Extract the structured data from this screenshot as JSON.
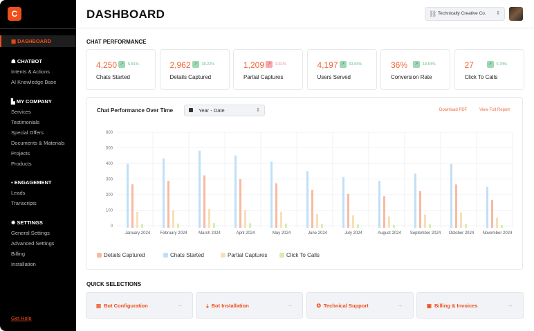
{
  "sidebar": {
    "logo": "C",
    "active": "DASHBOARD",
    "sections": [
      {
        "title": "CHATBOT",
        "icon": "robot-icon",
        "items": [
          "Intents & Actions",
          "AI Knowledge Base"
        ]
      },
      {
        "title": "MY COMPANY",
        "icon": "building-icon",
        "items": [
          "Services",
          "Testimonials",
          "Special Offers",
          "Documents & Materials",
          "Projects",
          "Products"
        ]
      },
      {
        "title": "ENGAGEMENT",
        "icon": "chat-icon",
        "items": [
          "Leads",
          "Transcripts"
        ]
      },
      {
        "title": "SETTINGS",
        "icon": "gear-icon",
        "items": [
          "General Settings",
          "Advanced Settings",
          "Billing",
          "Installation"
        ]
      }
    ],
    "help": "Get Help"
  },
  "header": {
    "title": "DASHBOARD",
    "company": "Technically Creative Co."
  },
  "performance": {
    "title": "CHAT PERFORMANCE",
    "cards": [
      {
        "value": "4,250",
        "change": "5.81%",
        "trend": "up",
        "label": "Chats Started"
      },
      {
        "value": "2,962",
        "change": "38.22%",
        "trend": "up",
        "label": "Details Captured"
      },
      {
        "value": "1,209",
        "change": "3.31%",
        "trend": "down",
        "label": "Partial Captures"
      },
      {
        "value": "4,197",
        "change": "53.56%",
        "trend": "up",
        "label": "Users Served"
      },
      {
        "value": "36%",
        "change": "18.54%",
        "trend": "up",
        "label": "Conversion Rate"
      },
      {
        "value": "27",
        "change": "6.78%",
        "trend": "up",
        "label": "Click To Calls"
      }
    ]
  },
  "chart_panel": {
    "title": "Chat Performance Over Time",
    "range": "Year - Date",
    "download": "Download PDF",
    "report": "View Full Report"
  },
  "chart_data": {
    "type": "bar",
    "ylim": [
      0,
      600
    ],
    "yticks": [
      0,
      100,
      200,
      300,
      400,
      500,
      600
    ],
    "grid": true,
    "legend": "bottom-left",
    "categories": [
      "January 2024",
      "February 2024",
      "March 2024",
      "April 2024",
      "May 2024",
      "June 2024",
      "July 2024",
      "August 2024",
      "September 2024",
      "October 2024",
      "November 2024"
    ],
    "series": [
      {
        "name": "Chats Started",
        "color": "#bfe0f7",
        "values": [
          397,
          432,
          482,
          451,
          412,
          350,
          312,
          288,
          335,
          397,
          250
        ]
      },
      {
        "name": "Details Captured",
        "color": "#f9b9a0",
        "values": [
          266,
          288,
          323,
          300,
          273,
          231,
          205,
          190,
          222,
          265,
          165
        ]
      },
      {
        "name": "Partial Captures",
        "color": "#f7e0b8",
        "values": [
          89,
          98,
          108,
          100,
          90,
          75,
          67,
          60,
          72,
          86,
          52
        ]
      },
      {
        "name": "Click To Calls",
        "color": "#d5eeb0",
        "values": [
          11,
          14,
          17,
          16,
          14,
          9,
          8,
          5,
          9,
          12,
          4
        ]
      }
    ],
    "legend_order": [
      "Details Captured",
      "Chats Started",
      "Partial Captures",
      "Click To Calls"
    ]
  },
  "quick": {
    "title": "QUICK SELECTIONS",
    "items": [
      {
        "label": "Bot Configuration",
        "icon": "document-icon",
        "glyph": "▤"
      },
      {
        "label": "Bot Installation",
        "icon": "download-icon",
        "glyph": "⤓"
      },
      {
        "label": "Technical Support",
        "icon": "lifebuoy-icon",
        "glyph": "✪"
      },
      {
        "label": "Billing & Invoices",
        "icon": "invoice-icon",
        "glyph": "▣"
      }
    ]
  },
  "colors": {
    "accent": "#f04e1b"
  }
}
